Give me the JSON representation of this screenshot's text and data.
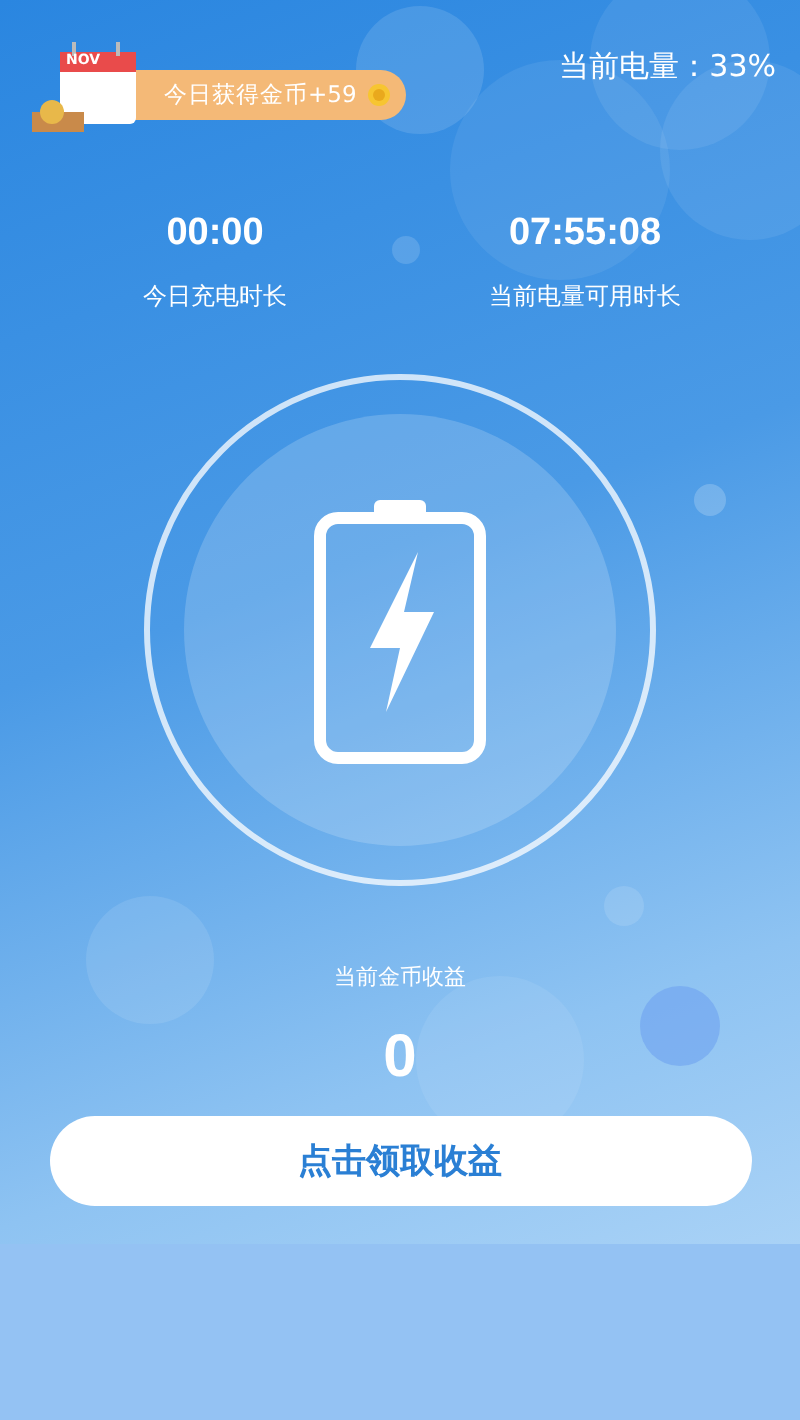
{
  "reward_badge": {
    "calendar_label": "NOV",
    "text": "今日获得金币+59"
  },
  "battery_level_text": "当前电量：33%",
  "stats": [
    {
      "value": "00:00",
      "label": "今日充电时长"
    },
    {
      "value": "07:55:08",
      "label": "当前电量可用时长"
    }
  ],
  "earnings": {
    "label": "当前金币收益",
    "value": "0"
  },
  "claim_button": {
    "label": "点击领取收益"
  }
}
